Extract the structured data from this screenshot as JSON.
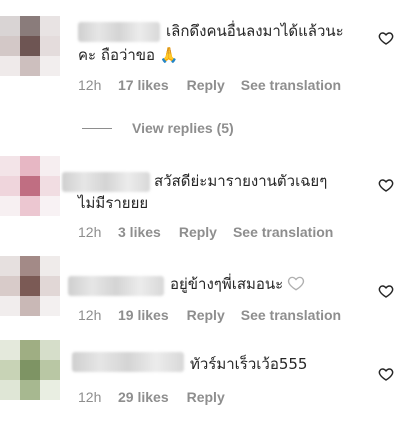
{
  "comments": [
    {
      "text_line1": "เลิกดึงคนอื่นลงมาได้แล้วนะ",
      "text_line2": "คะ ถือว่าขอ",
      "emoji": "🙏",
      "time": "12h",
      "likes": "17 likes",
      "reply": "Reply",
      "translate": "See translation"
    },
    {
      "text_line1": "สวัสดีย่ะมารายงานตัวเฉยๆ",
      "text_line2": "ไม่มีรายยย",
      "time": "12h",
      "likes": "3 likes",
      "reply": "Reply",
      "translate": "See translation"
    },
    {
      "text_line1": "อยู่ข้างๆพี่เสมอนะ",
      "time": "12h",
      "likes": "19 likes",
      "reply": "Reply",
      "translate": "See translation"
    },
    {
      "text_line1": "ทัวร์มาเร็วเว้อ555",
      "time": "12h",
      "likes": "29 likes",
      "reply": "Reply"
    }
  ],
  "view_replies": "View replies (5)",
  "icons": {
    "like": "heart-outline-icon"
  },
  "colors": {
    "text": "#262626",
    "secondary": "#8e8e8e"
  }
}
